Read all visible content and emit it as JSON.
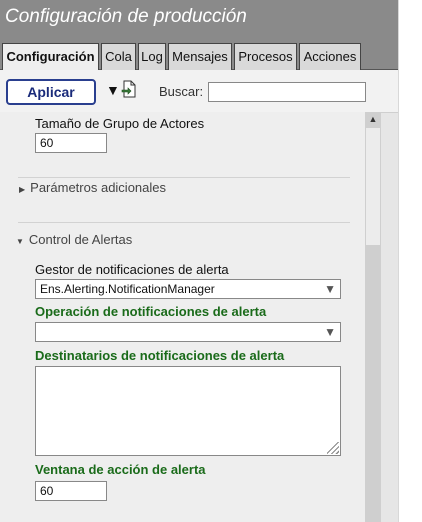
{
  "panel": {
    "title": "Configuración de producción"
  },
  "tabs": [
    {
      "label": "Configuración",
      "active": true
    },
    {
      "label": "Cola",
      "active": false
    },
    {
      "label": "Log",
      "active": false
    },
    {
      "label": "Mensajes",
      "active": false
    },
    {
      "label": "Procesos",
      "active": false
    },
    {
      "label": "Acciones",
      "active": false
    }
  ],
  "toolbar": {
    "apply_label": "Aplicar",
    "dropdown_icon": "triangle-down-icon",
    "document_icon": "document-arrow-icon",
    "search_label": "Buscar:",
    "search_value": ""
  },
  "settings": {
    "actor_pool_size": {
      "label": "Tamaño de Grupo de Actores",
      "value": "60"
    },
    "additional_params": {
      "label": "Parámetros adicionales",
      "expanded": false
    },
    "alert_control": {
      "label": "Control de Alertas",
      "expanded": true,
      "notification_manager": {
        "label": "Gestor de notificaciones de alerta",
        "value": "Ens.Alerting.NotificationManager"
      },
      "notification_operation": {
        "label": "Operación de notificaciones de alerta",
        "value": ""
      },
      "notification_recipients": {
        "label": "Destinatarios de notificaciones de alerta",
        "value": ""
      },
      "alert_action_window": {
        "label": "Ventana de acción de alerta",
        "value": "60"
      }
    }
  },
  "colors": {
    "title_bar": "#8a8a8a",
    "apply_border": "#2a3f8f",
    "required_label": "#1a6b1a"
  }
}
